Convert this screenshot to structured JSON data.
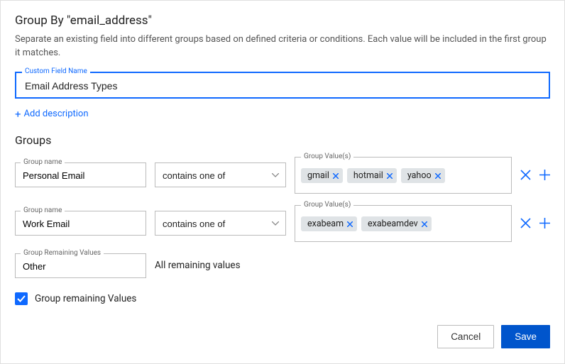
{
  "header": {
    "title": "Group By \"email_address\"",
    "subtitle": "Separate an existing field into different groups based on defined criteria or conditions. Each value will be included in the first group it matches."
  },
  "customField": {
    "label": "Custom Field Name",
    "value": "Email Address Types"
  },
  "addDescription": {
    "label": "Add description"
  },
  "groupsSection": {
    "title": "Groups",
    "groupNameLabel": "Group name",
    "groupValuesLabel": "Group Value(s)",
    "rows": [
      {
        "name": "Personal Email",
        "operator": "contains one of",
        "values": [
          "gmail",
          "hotmail",
          "yahoo"
        ]
      },
      {
        "name": "Work Email",
        "operator": "contains one of",
        "values": [
          "exabeam",
          "exabeamdev"
        ]
      }
    ],
    "remaining": {
      "label": "Group Remaining Values",
      "value": "Other",
      "text": "All remaining values"
    }
  },
  "checkbox": {
    "checked": true,
    "label": "Group remaining Values"
  },
  "footer": {
    "cancel": "Cancel",
    "save": "Save"
  }
}
